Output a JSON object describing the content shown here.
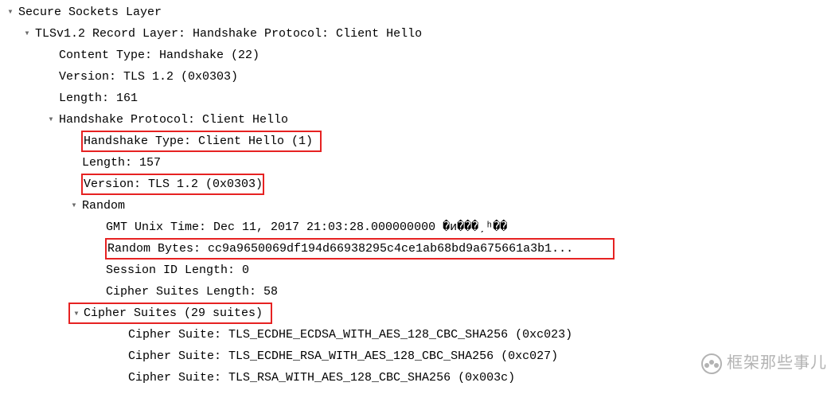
{
  "nodes": {
    "ssl": "Secure Sockets Layer",
    "record": "TLSv1.2 Record Layer: Handshake Protocol: Client Hello",
    "contentType": "Content Type: Handshake (22)",
    "recVersion": "Version: TLS 1.2 (0x0303)",
    "recLength": "Length: 161",
    "hsProtocol": "Handshake Protocol: Client Hello",
    "hsType": "Handshake Type: Client Hello (1)",
    "hsLength": "Length: 157",
    "hsVersion": "Version: TLS 1.2 (0x0303)",
    "random": "Random",
    "gmtTime": "GMT Unix Time: Dec 11, 2017 21:03:28.000000000 �и���ˏʰ��",
    "randomBytes": "Random Bytes: cc9a9650069df194d66938295c4ce1ab68bd9a675661a3b1...",
    "sessIdLen": "Session ID Length: 0",
    "csLength": "Cipher Suites Length: 58",
    "csHeader": "Cipher Suites (29 suites)",
    "cs0": "Cipher Suite: TLS_ECDHE_ECDSA_WITH_AES_128_CBC_SHA256 (0xc023)",
    "cs1": "Cipher Suite: TLS_ECDHE_RSA_WITH_AES_128_CBC_SHA256 (0xc027)",
    "cs2": "Cipher Suite: TLS_RSA_WITH_AES_128_CBC_SHA256 (0x003c)"
  },
  "watermark": "框架那些事儿",
  "arrowGlyph": "▾"
}
